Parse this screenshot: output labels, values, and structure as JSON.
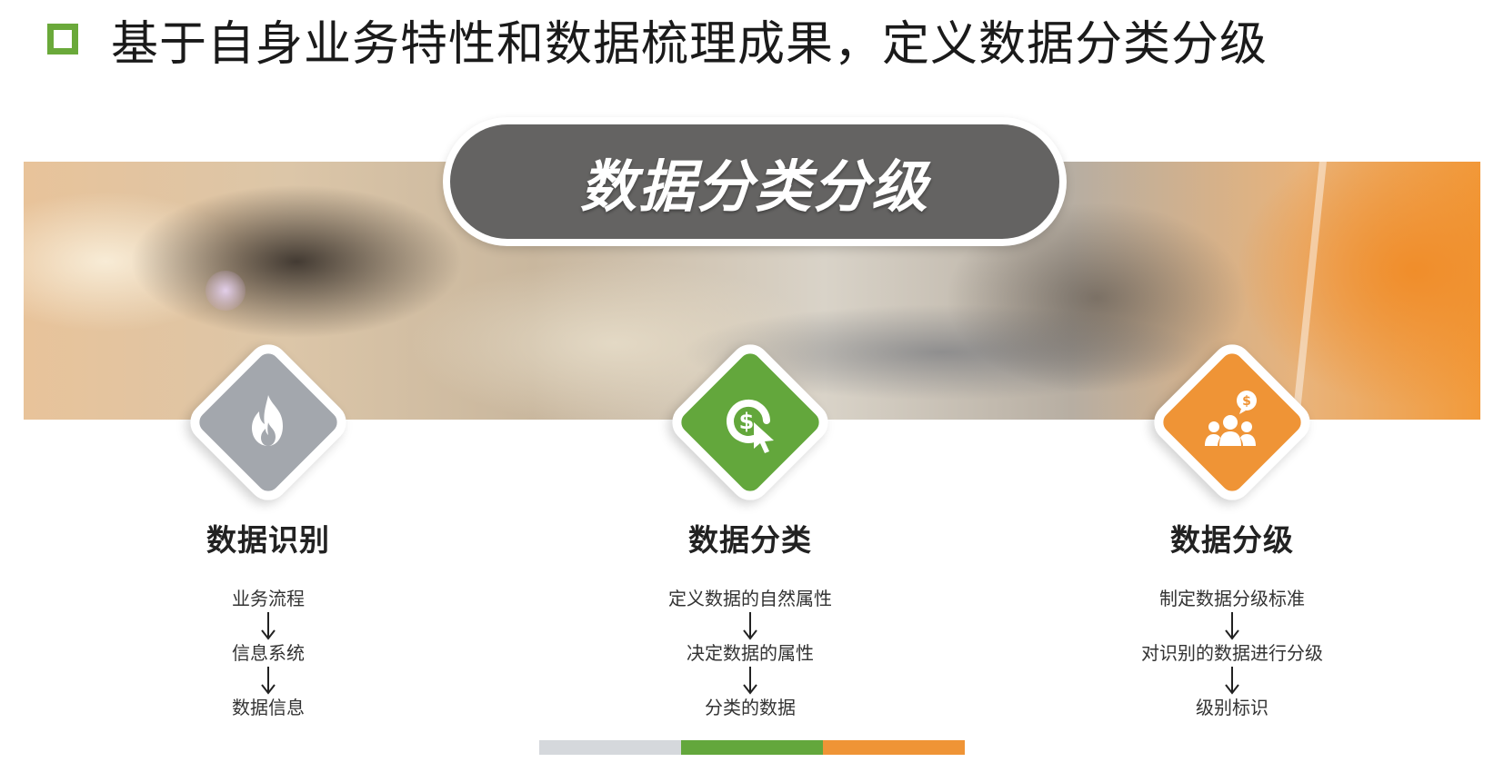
{
  "title": "基于自身业务特性和数据梳理成果，定义数据分类分级",
  "header": {
    "label": "数据分类分级"
  },
  "colors": {
    "accent_green": "#63a73c",
    "accent_gray": "#a3a7ad",
    "accent_orange": "#ef9436",
    "pill_bg": "#646362"
  },
  "columns": [
    {
      "heading": "数据识别",
      "icon": "flame-icon",
      "steps": [
        "业务流程",
        "信息系统",
        "数据信息"
      ]
    },
    {
      "heading": "数据分类",
      "icon": "dollar-cursor-icon",
      "steps": [
        "定义数据的自然属性",
        "决定数据的属性",
        "分类的数据"
      ]
    },
    {
      "heading": "数据分级",
      "icon": "people-dollar-icon",
      "steps": [
        "制定数据分级标准",
        "对识别的数据进行分级",
        "级别标识"
      ]
    }
  ]
}
